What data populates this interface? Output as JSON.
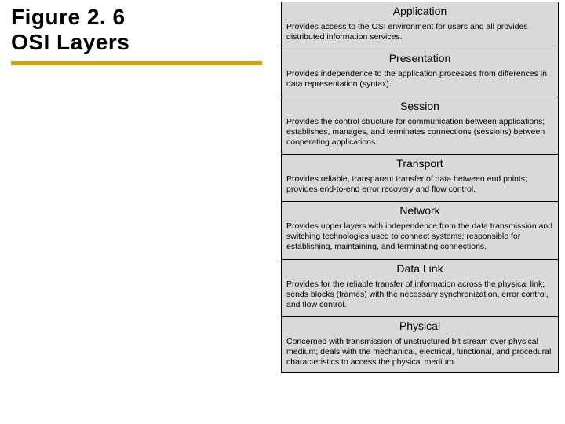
{
  "figure": {
    "title_line1": "Figure 2. 6",
    "title_line2": "OSI Layers"
  },
  "layers": [
    {
      "name": "Application",
      "desc": "Provides access to the OSI environment for users and all provides distributed information services."
    },
    {
      "name": "Presentation",
      "desc": "Provides independence to the application processes from differences in data representation (syntax)."
    },
    {
      "name": "Session",
      "desc": "Provides the control structure for communication between applications; establishes, manages, and terminates connections (sessions) between cooperating applications."
    },
    {
      "name": "Transport",
      "desc": "Provides reliable, transparent transfer of data between end points; provides end-to-end error recovery and flow control."
    },
    {
      "name": "Network",
      "desc": "Provides upper layers with independence from the data transmission and switching technologies used to connect systems; responsible for establishing, maintaining, and terminating connections."
    },
    {
      "name": "Data Link",
      "desc": "Provides for the reliable transfer of information across the physical link; sends blocks (frames) with the necessary synchronization, error control, and flow control."
    },
    {
      "name": "Physical",
      "desc": "Concerned with transmission of unstructured bit stream over physical medium; deals with the mechanical, electrical, functional, and procedural characteristics to access the physical medium."
    }
  ]
}
